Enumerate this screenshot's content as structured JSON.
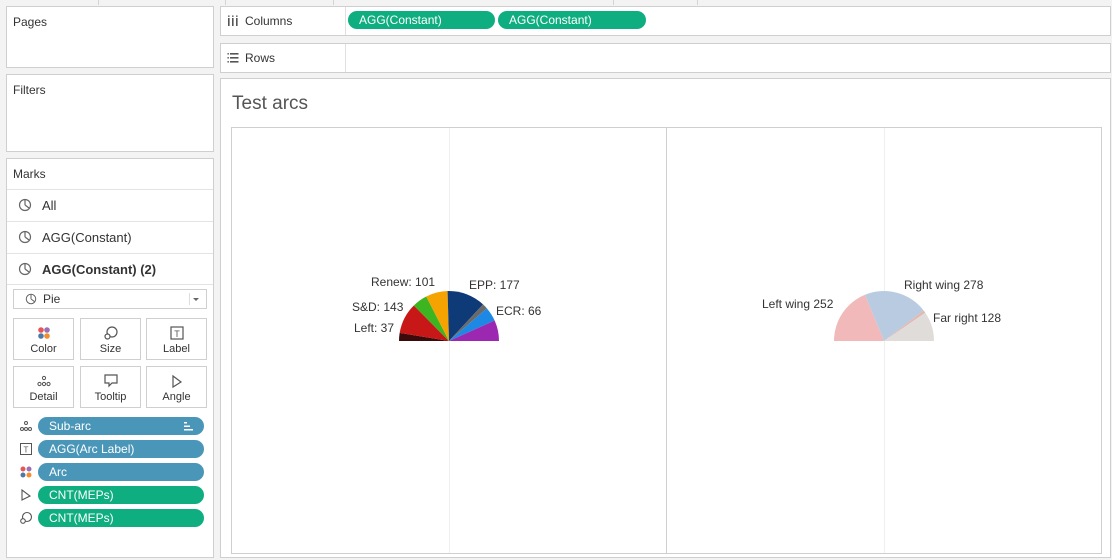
{
  "pages": {
    "title": "Pages"
  },
  "filters": {
    "title": "Filters"
  },
  "columns_shelf": {
    "label": "Columns",
    "pills": [
      "AGG(Constant)",
      "AGG(Constant)"
    ]
  },
  "rows_shelf": {
    "label": "Rows"
  },
  "marks": {
    "title": "Marks",
    "layers": [
      {
        "label": "All",
        "bold": false
      },
      {
        "label": "AGG(Constant)",
        "bold": false
      },
      {
        "label": "AGG(Constant) (2)",
        "bold": true
      }
    ],
    "mark_type": "Pie",
    "buttons": [
      "Color",
      "Size",
      "Label",
      "Detail",
      "Tooltip",
      "Angle"
    ],
    "fields": [
      {
        "label": "Sub-arc",
        "icon": "detail-icon",
        "color": "#4a96b8"
      },
      {
        "label": "AGG(Arc Label)",
        "icon": "label-icon",
        "color": "#4a96b8"
      },
      {
        "label": "Arc",
        "icon": "color-icon",
        "color": "#4a96b8"
      },
      {
        "label": "CNT(MEPs)",
        "icon": "angle-icon",
        "color": "#0fae80"
      },
      {
        "label": "CNT(MEPs)",
        "icon": "size-icon",
        "color": "#0fae80"
      }
    ]
  },
  "viz": {
    "title": "Test arcs"
  },
  "chart_data": [
    {
      "type": "pie",
      "subtype": "half-donut arc",
      "title": "",
      "slices": [
        {
          "label": "Left: 37",
          "value": 37,
          "color": "#3b0a0a"
        },
        {
          "label": "S&D: 143",
          "value": 143,
          "color": "#c81717"
        },
        {
          "label": "",
          "value": 70,
          "color": "#3cb521"
        },
        {
          "label": "Renew: 101",
          "value": 101,
          "color": "#f5a300"
        },
        {
          "label": "EPP: 177",
          "value": 177,
          "color": "#0e3a78"
        },
        {
          "label": "",
          "value": 25,
          "color": "#6a6a6a"
        },
        {
          "label": "ECR: 66",
          "value": 66,
          "color": "#1e88e5"
        },
        {
          "label": "",
          "value": 96,
          "color": "#9c27b0"
        }
      ]
    },
    {
      "type": "pie",
      "subtype": "half-donut arc",
      "title": "",
      "slices": [
        {
          "label": "Left wing 252",
          "value": 252,
          "color": "#f1b9b9"
        },
        {
          "label": "Right wing 278",
          "value": 278,
          "color": "#b9cbe0"
        },
        {
          "label": "",
          "value": 12,
          "color": "#e3b8b0"
        },
        {
          "label": "Far right 128",
          "value": 128,
          "color": "#e0dcda"
        }
      ]
    }
  ]
}
